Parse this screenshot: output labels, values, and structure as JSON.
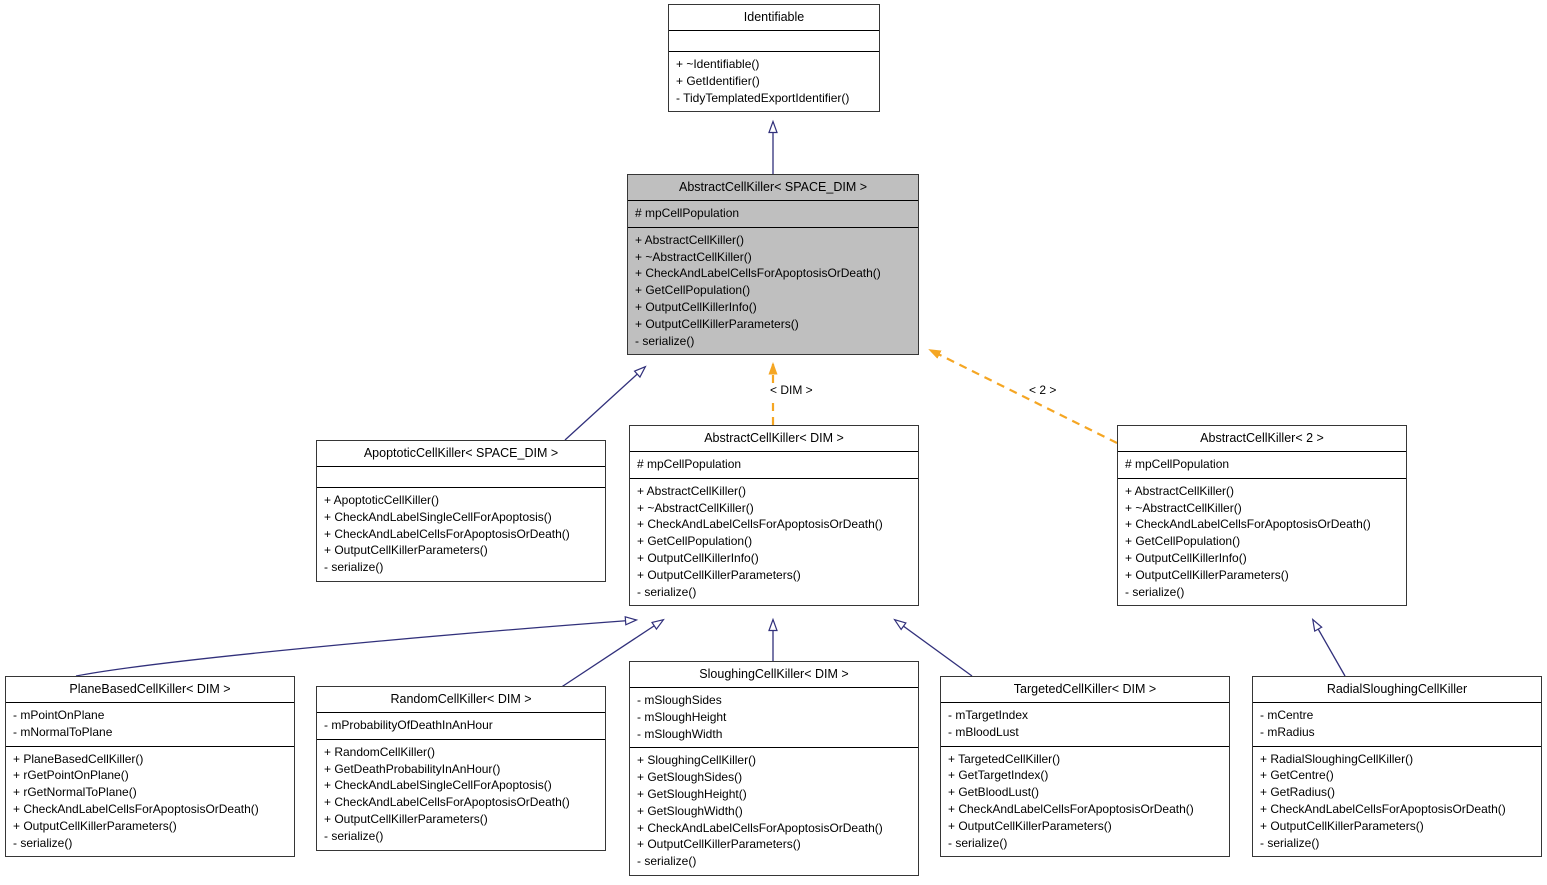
{
  "diagram": {
    "type": "uml-class-inheritance",
    "title": "AbstractCellKiller inheritance diagram",
    "colors": {
      "inheritance_edge": "#31307b",
      "instantiation_edge": "#f5a623",
      "highlight_fill": "#bfbfbf",
      "node_border": "#363636",
      "background": "#ffffff"
    },
    "edge_labels": [
      {
        "id": "lbl-dim",
        "text": "< DIM >"
      },
      {
        "id": "lbl-2",
        "text": "< 2 >"
      }
    ]
  },
  "nodes": {
    "identifiable": {
      "title": "Identifiable",
      "attributes": [],
      "operations": [
        "+ ~Identifiable()",
        "+ GetIdentifier()",
        "- TidyTemplatedExportIdentifier()"
      ]
    },
    "abstract_cell_killer_space_dim": {
      "title": "AbstractCellKiller< SPACE_DIM >",
      "attributes": [
        "# mpCellPopulation"
      ],
      "operations": [
        "+ AbstractCellKiller()",
        "+ ~AbstractCellKiller()",
        "+ CheckAndLabelCellsForApoptosisOrDeath()",
        "+ GetCellPopulation()",
        "+ OutputCellKillerInfo()",
        "+ OutputCellKillerParameters()",
        "- serialize()"
      ]
    },
    "apoptotic_cell_killer": {
      "title": "ApoptoticCellKiller< SPACE_DIM >",
      "attributes": [],
      "operations": [
        "+ ApoptoticCellKiller()",
        "+ CheckAndLabelSingleCellForApoptosis()",
        "+ CheckAndLabelCellsForApoptosisOrDeath()",
        "+ OutputCellKillerParameters()",
        "- serialize()"
      ]
    },
    "abstract_cell_killer_dim": {
      "title": "AbstractCellKiller< DIM >",
      "attributes": [
        "# mpCellPopulation"
      ],
      "operations": [
        "+ AbstractCellKiller()",
        "+ ~AbstractCellKiller()",
        "+ CheckAndLabelCellsForApoptosisOrDeath()",
        "+ GetCellPopulation()",
        "+ OutputCellKillerInfo()",
        "+ OutputCellKillerParameters()",
        "- serialize()"
      ]
    },
    "abstract_cell_killer_2": {
      "title": "AbstractCellKiller< 2 >",
      "attributes": [
        "# mpCellPopulation"
      ],
      "operations": [
        "+ AbstractCellKiller()",
        "+ ~AbstractCellKiller()",
        "+ CheckAndLabelCellsForApoptosisOrDeath()",
        "+ GetCellPopulation()",
        "+ OutputCellKillerInfo()",
        "+ OutputCellKillerParameters()",
        "- serialize()"
      ]
    },
    "plane_based_cell_killer": {
      "title": "PlaneBasedCellKiller< DIM >",
      "attributes": [
        "- mPointOnPlane",
        "- mNormalToPlane"
      ],
      "operations": [
        "+ PlaneBasedCellKiller()",
        "+ rGetPointOnPlane()",
        "+ rGetNormalToPlane()",
        "+ CheckAndLabelCellsForApoptosisOrDeath()",
        "+ OutputCellKillerParameters()",
        "- serialize()"
      ]
    },
    "random_cell_killer": {
      "title": "RandomCellKiller< DIM >",
      "attributes": [
        "- mProbabilityOfDeathInAnHour"
      ],
      "operations": [
        "+ RandomCellKiller()",
        "+ GetDeathProbabilityInAnHour()",
        "+ CheckAndLabelSingleCellForApoptosis()",
        "+ CheckAndLabelCellsForApoptosisOrDeath()",
        "+ OutputCellKillerParameters()",
        "- serialize()"
      ]
    },
    "sloughing_cell_killer": {
      "title": "SloughingCellKiller< DIM >",
      "attributes": [
        "- mSloughSides",
        "- mSloughHeight",
        "- mSloughWidth"
      ],
      "operations": [
        "+ SloughingCellKiller()",
        "+ GetSloughSides()",
        "+ GetSloughHeight()",
        "+ GetSloughWidth()",
        "+ CheckAndLabelCellsForApoptosisOrDeath()",
        "+ OutputCellKillerParameters()",
        "- serialize()"
      ]
    },
    "targeted_cell_killer": {
      "title": "TargetedCellKiller< DIM >",
      "attributes": [
        "- mTargetIndex",
        "- mBloodLust"
      ],
      "operations": [
        "+ TargetedCellKiller()",
        "+ GetTargetIndex()",
        "+ GetBloodLust()",
        "+ CheckAndLabelCellsForApoptosisOrDeath()",
        "+ OutputCellKillerParameters()",
        "- serialize()"
      ]
    },
    "radial_sloughing_cell_killer": {
      "title": "RadialSloughingCellKiller",
      "attributes": [
        "- mCentre",
        "- mRadius"
      ],
      "operations": [
        "+ RadialSloughingCellKiller()",
        "+ GetCentre()",
        "+ GetRadius()",
        "+ CheckAndLabelCellsForApoptosisOrDeath()",
        "+ OutputCellKillerParameters()",
        "- serialize()"
      ]
    }
  }
}
